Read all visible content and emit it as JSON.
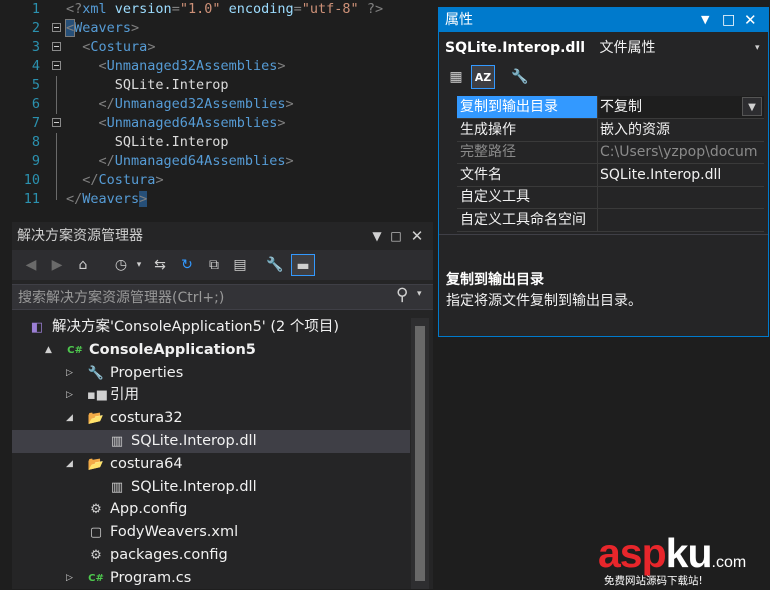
{
  "editor": {
    "lines": [
      {
        "num": "1",
        "parts": [
          [
            "c-punc",
            "<?"
          ],
          [
            "c-tag",
            "xml "
          ],
          [
            "c-attr",
            "version"
          ],
          [
            "c-punc",
            "="
          ],
          [
            "c-str",
            "\"1.0\" "
          ],
          [
            "c-attr",
            "encoding"
          ],
          [
            "c-punc",
            "="
          ],
          [
            "c-str",
            "\"utf-8\" "
          ],
          [
            "c-punc",
            "?>"
          ]
        ]
      },
      {
        "num": "2",
        "parts": [
          [
            "c-punc",
            "<"
          ],
          [
            "c-tag",
            "Weavers"
          ],
          [
            "c-punc",
            ">"
          ]
        ]
      },
      {
        "num": "3",
        "parts": [
          [
            "c-text",
            "  "
          ],
          [
            "c-punc",
            "<"
          ],
          [
            "c-tag",
            "Costura"
          ],
          [
            "c-punc",
            ">"
          ]
        ]
      },
      {
        "num": "4",
        "parts": [
          [
            "c-text",
            "    "
          ],
          [
            "c-punc",
            "<"
          ],
          [
            "c-tag",
            "Unmanaged32Assemblies"
          ],
          [
            "c-punc",
            ">"
          ]
        ]
      },
      {
        "num": "5",
        "parts": [
          [
            "c-text",
            "      SQLite.Interop"
          ]
        ]
      },
      {
        "num": "6",
        "parts": [
          [
            "c-text",
            "    "
          ],
          [
            "c-punc",
            "</"
          ],
          [
            "c-tag",
            "Unmanaged32Assemblies"
          ],
          [
            "c-punc",
            ">"
          ]
        ]
      },
      {
        "num": "7",
        "parts": [
          [
            "c-text",
            "    "
          ],
          [
            "c-punc",
            "<"
          ],
          [
            "c-tag",
            "Unmanaged64Assemblies"
          ],
          [
            "c-punc",
            ">"
          ]
        ]
      },
      {
        "num": "8",
        "parts": [
          [
            "c-text",
            "      SQLite.Interop"
          ]
        ]
      },
      {
        "num": "9",
        "parts": [
          [
            "c-text",
            "    "
          ],
          [
            "c-punc",
            "</"
          ],
          [
            "c-tag",
            "Unmanaged64Assemblies"
          ],
          [
            "c-punc",
            ">"
          ]
        ]
      },
      {
        "num": "10",
        "parts": [
          [
            "c-text",
            "  "
          ],
          [
            "c-punc",
            "</"
          ],
          [
            "c-tag",
            "Costura"
          ],
          [
            "c-punc",
            ">"
          ]
        ]
      },
      {
        "num": "11",
        "parts": [
          [
            "c-punc",
            "</"
          ],
          [
            "c-tag",
            "Weavers"
          ],
          [
            "c-punc",
            ">"
          ]
        ]
      }
    ]
  },
  "solution_explorer": {
    "title": "解决方案资源管理器",
    "search_placeholder": "搜索解决方案资源管理器(Ctrl+;)",
    "tree": [
      {
        "label": "解决方案'ConsoleApplication5' (2 个项目)",
        "icon": "solution-icon",
        "glyph": "◧",
        "indent": 0,
        "arrow": "",
        "bold": false
      },
      {
        "label": "ConsoleApplication5",
        "icon": "csharp-project-icon",
        "glyph": "C#",
        "indent": 0,
        "arrow": "▲",
        "bold": true
      },
      {
        "label": "Properties",
        "icon": "wrench-icon",
        "glyph": "🔧",
        "indent": 1,
        "arrow": "▷",
        "bold": false
      },
      {
        "label": "引用",
        "icon": "references-icon",
        "glyph": "▪■",
        "indent": 1,
        "arrow": "▷",
        "bold": false
      },
      {
        "label": "costura32",
        "icon": "folder-icon",
        "glyph": "📂",
        "indent": 1,
        "arrow": "◢",
        "bold": false
      },
      {
        "label": "SQLite.Interop.dll",
        "icon": "dll-file-icon",
        "glyph": "▥",
        "indent": 2,
        "arrow": "",
        "bold": false,
        "selected": true
      },
      {
        "label": "costura64",
        "icon": "folder-icon",
        "glyph": "📂",
        "indent": 1,
        "arrow": "◢",
        "bold": false
      },
      {
        "label": "SQLite.Interop.dll",
        "icon": "dll-file-icon",
        "glyph": "▥",
        "indent": 2,
        "arrow": "",
        "bold": false
      },
      {
        "label": "App.config",
        "icon": "config-file-icon",
        "glyph": "⚙",
        "indent": 1,
        "arrow": "",
        "bold": false
      },
      {
        "label": "FodyWeavers.xml",
        "icon": "xml-file-icon",
        "glyph": "▢",
        "indent": 1,
        "arrow": "",
        "bold": false
      },
      {
        "label": "packages.config",
        "icon": "config-file-icon",
        "glyph": "⚙",
        "indent": 1,
        "arrow": "",
        "bold": false
      },
      {
        "label": "Program.cs",
        "icon": "csharp-file-icon",
        "glyph": "C#",
        "indent": 1,
        "arrow": "▷",
        "bold": false
      }
    ]
  },
  "properties": {
    "title": "属性",
    "object_name": "SQLite.Interop.dll",
    "object_type": "文件属性",
    "rows": [
      {
        "name": "复制到输出目录",
        "value": "不复制",
        "selected": true,
        "dropdown": true
      },
      {
        "name": "生成操作",
        "value": "嵌入的资源"
      },
      {
        "name": "完整路径",
        "value": "C:\\Users\\yzpop\\docum",
        "dim": true
      },
      {
        "name": "文件名",
        "value": "SQLite.Interop.dll"
      },
      {
        "name": "自定义工具",
        "value": ""
      },
      {
        "name": "自定义工具命名空间",
        "value": ""
      }
    ],
    "desc_title": "复制到输出目录",
    "desc_text": "指定将源文件复制到输出目录。"
  },
  "watermark": {
    "brand_a": "asp",
    "brand_b": "ku",
    "domain": ".com",
    "tagline": "免费网站源码下载站!"
  },
  "colors": {
    "accent": "#007acc",
    "watermark_red": "#e8262b",
    "selection": "#3399ff"
  }
}
